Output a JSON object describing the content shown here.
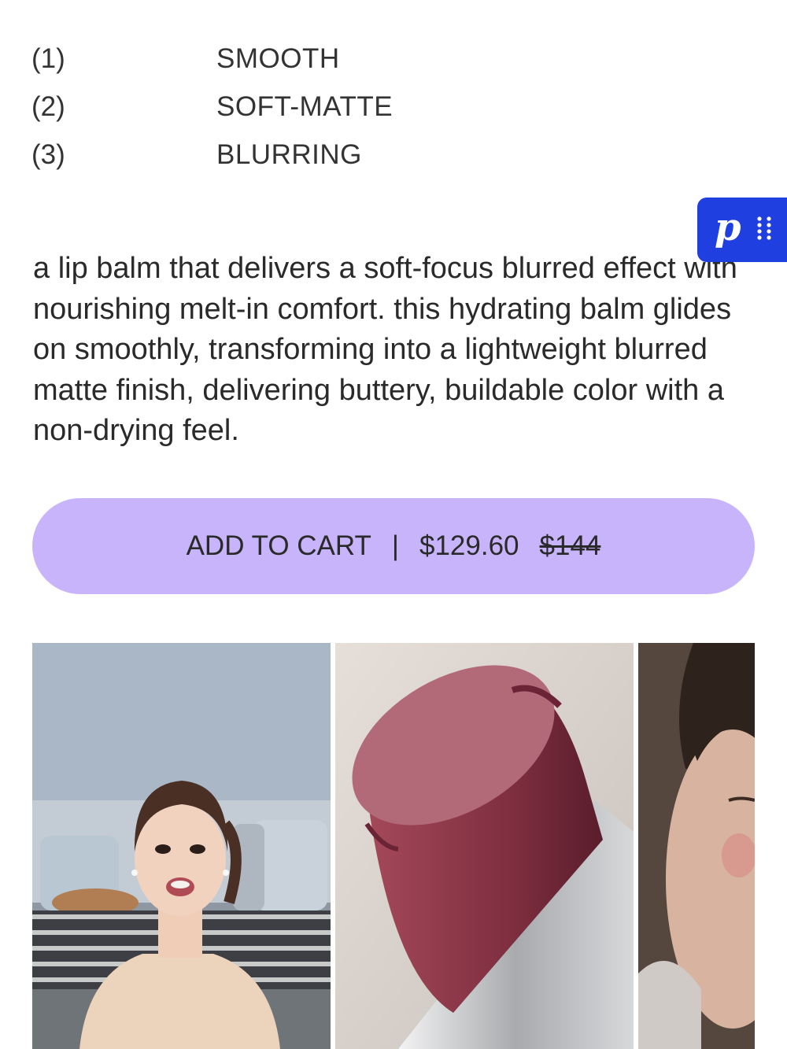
{
  "features": [
    {
      "num": "(1)",
      "name": "SMOOTH"
    },
    {
      "num": "(2)",
      "name": "SOFT-MATTE"
    },
    {
      "num": "(3)",
      "name": "BLURRING"
    }
  ],
  "description": "a lip balm that delivers a soft-focus blurred effect with nourishing melt-in comfort. this hydrating balm glides on smoothly, transforming into a lightweight blurred matte finish, delivering buttery, buildable color with a non-drying feel.",
  "cart": {
    "label": "ADD TO CART",
    "separator": "|",
    "price": "$129.60",
    "original_price": "$144",
    "color": "#c7b4fb"
  },
  "widget": {
    "logo": "p",
    "icon": "drag-handle-icon",
    "color": "#1f3fe0"
  },
  "gallery": {
    "images": [
      "model-video-thumbnail",
      "lipstick-closeup",
      "model-face-closeup"
    ]
  }
}
